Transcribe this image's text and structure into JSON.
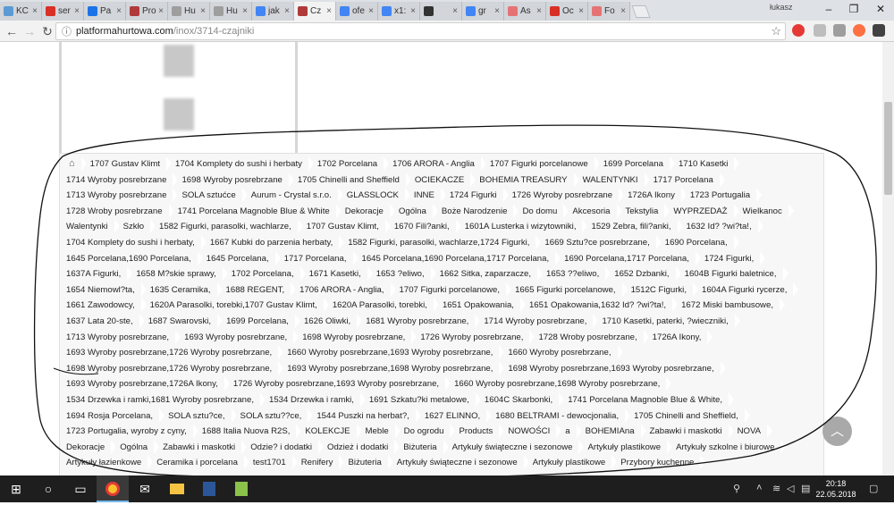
{
  "browser": {
    "tabs": [
      {
        "title": "KC",
        "color": "#5b9bd5"
      },
      {
        "title": "ser",
        "color": "#d93025"
      },
      {
        "title": "Pa",
        "color": "#1a73e8"
      },
      {
        "title": "Pro",
        "color": "#b03a3a"
      },
      {
        "title": "Hu",
        "color": "#9e9e9e"
      },
      {
        "title": "Hu",
        "color": "#9e9e9e"
      },
      {
        "title": "jak",
        "color": "#4285f4"
      },
      {
        "title": "Cz",
        "color": "#b03a3a"
      },
      {
        "title": "ofe",
        "color": "#4285f4"
      },
      {
        "title": "x1:",
        "color": "#4285f4"
      },
      {
        "title": "",
        "color": "#333333"
      },
      {
        "title": "gr",
        "color": "#4285f4"
      },
      {
        "title": "As",
        "color": "#e57373"
      },
      {
        "title": "Oc",
        "color": "#d93025"
      },
      {
        "title": "Fo",
        "color": "#e57373"
      }
    ],
    "active_tab_index": 7,
    "user": "łukasz",
    "url_host": "platformahurtowa.com",
    "url_path": "/inox/3714-czajniki"
  },
  "tags": [
    "1707 Gustav Klimt",
    "1704 Komplety do sushi i herbaty",
    "1702 Porcelana",
    "1706 ARORA - Anglia",
    "1707 Figurki porcelanowe",
    "1699 Porcelana",
    "1710 Kasetki",
    "1714 Wyroby posrebrzane",
    "1698 Wyroby posrebrzane",
    "1705 Chinelli and Sheffield",
    "OCIEKACZE",
    "BOHEMIA TREASURY",
    "WALENTYNKI",
    "1717 Porcelana",
    "1713 Wyroby posrebrzane",
    "SOLA sztućce",
    "Aurum - Crystal s.r.o.",
    "GLASSLOCK",
    "INNE",
    "1724 Figurki",
    "1726 Wyroby posrebrzane",
    "1726A Ikony",
    "1723 Portugalia",
    "1728 Wroby posrebrzane",
    "1741 Porcelana Magnoble Blue & White",
    "Dekoracje",
    "Ogólna",
    "Boże Narodzenie",
    "Do domu",
    "Akcesoria",
    "Tekstylia",
    "WYPRZEDAŻ",
    "Wielkanoc",
    "Walentynki",
    "Szkło",
    "1582 Figurki, parasolki, wachlarze,",
    "1707 Gustav Klimt,",
    "1670 Fili?anki,",
    "1601A Lusterka i wizytowniki,",
    "1529 Zebra, fili?anki,",
    "1632 Id? ?wi?ta!,",
    "1704 Komplety do sushi i herbaty,",
    "1667 Kubki do parzenia herbaty,",
    "1582 Figurki, parasolki, wachlarze,1724 Figurki,",
    "1669 Sztu?ce posrebrzane,",
    "1690 Porcelana,",
    "1645 Porcelana,1690 Porcelana,",
    "1645 Porcelana,",
    "1717 Porcelana,",
    "1645 Porcelana,1690 Porcelana,1717 Porcelana,",
    "1690 Porcelana,1717 Porcelana,",
    "1724 Figurki,",
    "1637A Figurki,",
    "1658 M?skie sprawy,",
    "1702 Porcelana,",
    "1671 Kasetki,",
    "1653 ?eliwo,",
    "1662 Sitka, zaparzacze,",
    "1653 ??eliwo,",
    "1652 Dzbanki,",
    "1604B Figurki baletnice,",
    "1654 Niemowl?ta,",
    "1635 Ceramika,",
    "1688 REGENT,",
    "1706 ARORA - Anglia,",
    "1707 Figurki porcelanowe,",
    "1665 Figurki porcelanowe,",
    "1512C Figurki,",
    "1604A Figurki rycerze,",
    "1661 Zawodowcy,",
    "1620A Parasolki, torebki,1707 Gustav Klimt,",
    "1620A Parasolki, torebki,",
    "1651 Opakowania,",
    "1651 Opakowania,1632 Id? ?wi?ta!,",
    "1672 Miski bambusowe,",
    "1637 Lata 20-ste,",
    "1687 Swarovski,",
    "1699 Porcelana,",
    "1626 Oliwki,",
    "1681 Wyroby posrebrzane,",
    "1714 Wyroby posrebrzane,",
    "1710 Kasetki, paterki, ?wieczniki,",
    "1713 Wyroby posrebrzane,",
    "1693 Wyroby posrebrzane,",
    "1698 Wyroby posrebrzane,",
    "1726 Wyroby posrebrzane,",
    "1728 Wroby posrebrzane,",
    "1726A Ikony,",
    "1693 Wyroby posrebrzane,1726 Wyroby posrebrzane,",
    "1660 Wyroby posrebrzane,1693 Wyroby posrebrzane,",
    "1660 Wyroby posrebrzane,",
    "1698 Wyroby posrebrzane,1726 Wyroby posrebrzane,",
    "1693 Wyroby posrebrzane,1698 Wyroby posrebrzane,",
    "1698 Wyroby posrebrzane,1693 Wyroby posrebrzane,",
    "1693 Wyroby posrebrzane,1726A Ikony,",
    "1726 Wyroby posrebrzane,1693 Wyroby posrebrzane,",
    "1660 Wyroby posrebrzane,1698 Wyroby posrebrzane,",
    "1534 Drzewka i ramki,1681 Wyroby posrebrzane,",
    "1534 Drzewka i ramki,",
    "1691 Szkatu?ki metalowe,",
    "1604C Skarbonki,",
    "1741 Porcelana Magnoble Blue & White,",
    "1694 Rosja Porcelana,",
    "SOLA sztu?ce,",
    "SOLA sztu??ce,",
    "1544 Puszki na herbat?,",
    "1627 ELINNO,",
    "1680 BELTRAMI - dewocjonalia,",
    "1705 Chinelli and Sheffield,",
    "1723 Portugalia, wyroby z cyny,",
    "1688 Italia Nuova R2S,",
    "KOLEKCJE",
    "Meble",
    "Do ogrodu",
    "Products",
    "NOWOŚCI",
    "a",
    "BOHEMIAna",
    "Zabawki i maskotki",
    "NOVA",
    "Dekoracje",
    "Ogólna",
    "Zabawki i maskotki",
    "Odzie? i dodatki",
    "Odzież i dodatki",
    "Biżuteria",
    "Artykuły świąteczne i sezonowe",
    "Artykuły plastikowe",
    "Artykuły szkolne i biurowe",
    "Artykuły łazienkowe",
    "Ceramika i porcelana",
    "test1701",
    "Renifery",
    "Biżuteria",
    "Artykuły świąteczne i sezonowe",
    "Artykuły plastikowe",
    "Przybory kuchenne"
  ],
  "taskbar": {
    "time": "20:18",
    "date": "22.05.2018"
  }
}
